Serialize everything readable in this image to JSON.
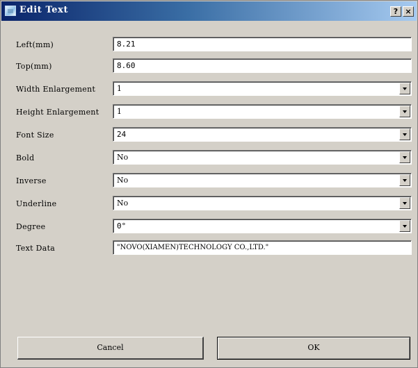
{
  "window": {
    "title": "Edit Text",
    "help_label": "?",
    "close_label": "×"
  },
  "fields": {
    "left": {
      "label": "Left(mm)",
      "value": "8.21"
    },
    "top": {
      "label": "Top(mm)",
      "value": "8.60"
    },
    "width_enlargement": {
      "label": "Width Enlargement",
      "value": "1"
    },
    "height_enlargement": {
      "label": "Height Enlargement",
      "value": "1"
    },
    "font_size": {
      "label": "Font Size",
      "value": "24"
    },
    "bold": {
      "label": "Bold",
      "value": "No"
    },
    "inverse": {
      "label": "Inverse",
      "value": "No"
    },
    "underline": {
      "label": "Underline",
      "value": "No"
    },
    "degree": {
      "label": "Degree",
      "value": "0°"
    },
    "text_data": {
      "label": "Text Data",
      "value": "\"NOVO(XIAMEN)TECHNOLOGY CO.,LTD.\""
    }
  },
  "buttons": {
    "cancel": "Cancel",
    "ok": "OK"
  },
  "icons": {
    "app": "app-icon",
    "help": "help-icon",
    "close": "close-icon",
    "dropdown": "chevron-down-icon"
  }
}
